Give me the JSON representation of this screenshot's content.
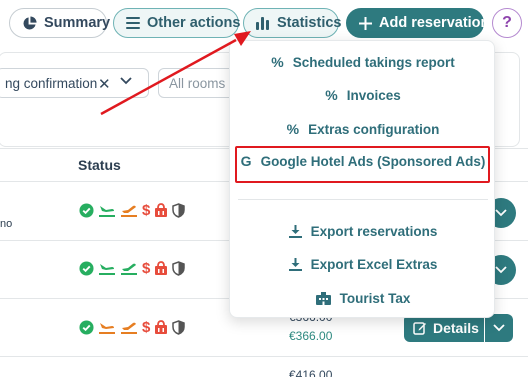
{
  "toolbar": {
    "summary_label": "Summary",
    "other_actions_label": "Other actions",
    "statistics_label": "Statistics",
    "add_reservation_label": "Add reservation",
    "help_label": "?"
  },
  "filters": {
    "status_value": "ng confirmation",
    "rooms_placeholder": "All rooms"
  },
  "table": {
    "status_header": "Status",
    "partial_text": "no",
    "details_label": "Details",
    "prices": [
      "€366.00",
      "€366.00",
      "€416.00"
    ]
  },
  "dropdown": {
    "items": [
      {
        "label": "Scheduled takings report",
        "icon": "percent-icon"
      },
      {
        "label": "Invoices",
        "icon": "percent-icon"
      },
      {
        "label": "Extras configuration",
        "icon": "percent-icon"
      },
      {
        "label": "Google Hotel Ads (Sponsored Ads)",
        "icon": "google-icon"
      },
      {
        "label": "Export reservations",
        "icon": "download-icon"
      },
      {
        "label": "Export Excel Extras",
        "icon": "download-icon"
      },
      {
        "label": "Tourist Tax",
        "icon": "building-icon"
      }
    ]
  },
  "colors": {
    "teal_primary": "#2e7a7f",
    "menu_text": "#2f6e7a",
    "annotation_red": "#e0191f",
    "status_green": "#27ae60",
    "status_orange": "#e67e22",
    "status_red": "#e74c3c"
  }
}
